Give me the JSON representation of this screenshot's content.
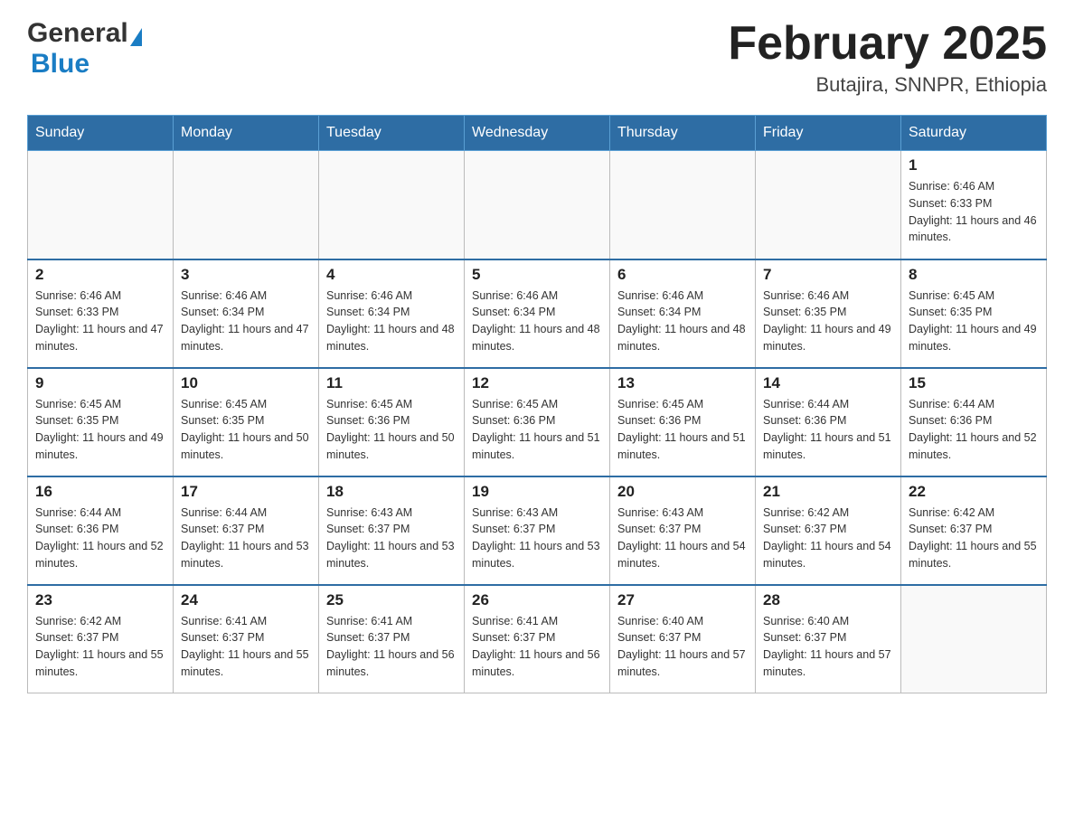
{
  "header": {
    "logo_general": "General",
    "logo_blue": "Blue",
    "month_title": "February 2025",
    "subtitle": "Butajira, SNNPR, Ethiopia"
  },
  "days_of_week": [
    "Sunday",
    "Monday",
    "Tuesday",
    "Wednesday",
    "Thursday",
    "Friday",
    "Saturday"
  ],
  "weeks": [
    [
      {
        "day": "",
        "sunrise": "",
        "sunset": "",
        "daylight": "",
        "empty": true
      },
      {
        "day": "",
        "sunrise": "",
        "sunset": "",
        "daylight": "",
        "empty": true
      },
      {
        "day": "",
        "sunrise": "",
        "sunset": "",
        "daylight": "",
        "empty": true
      },
      {
        "day": "",
        "sunrise": "",
        "sunset": "",
        "daylight": "",
        "empty": true
      },
      {
        "day": "",
        "sunrise": "",
        "sunset": "",
        "daylight": "",
        "empty": true
      },
      {
        "day": "",
        "sunrise": "",
        "sunset": "",
        "daylight": "",
        "empty": true
      },
      {
        "day": "1",
        "sunrise": "Sunrise: 6:46 AM",
        "sunset": "Sunset: 6:33 PM",
        "daylight": "Daylight: 11 hours and 46 minutes.",
        "empty": false
      }
    ],
    [
      {
        "day": "2",
        "sunrise": "Sunrise: 6:46 AM",
        "sunset": "Sunset: 6:33 PM",
        "daylight": "Daylight: 11 hours and 47 minutes.",
        "empty": false
      },
      {
        "day": "3",
        "sunrise": "Sunrise: 6:46 AM",
        "sunset": "Sunset: 6:34 PM",
        "daylight": "Daylight: 11 hours and 47 minutes.",
        "empty": false
      },
      {
        "day": "4",
        "sunrise": "Sunrise: 6:46 AM",
        "sunset": "Sunset: 6:34 PM",
        "daylight": "Daylight: 11 hours and 48 minutes.",
        "empty": false
      },
      {
        "day": "5",
        "sunrise": "Sunrise: 6:46 AM",
        "sunset": "Sunset: 6:34 PM",
        "daylight": "Daylight: 11 hours and 48 minutes.",
        "empty": false
      },
      {
        "day": "6",
        "sunrise": "Sunrise: 6:46 AM",
        "sunset": "Sunset: 6:34 PM",
        "daylight": "Daylight: 11 hours and 48 minutes.",
        "empty": false
      },
      {
        "day": "7",
        "sunrise": "Sunrise: 6:46 AM",
        "sunset": "Sunset: 6:35 PM",
        "daylight": "Daylight: 11 hours and 49 minutes.",
        "empty": false
      },
      {
        "day": "8",
        "sunrise": "Sunrise: 6:45 AM",
        "sunset": "Sunset: 6:35 PM",
        "daylight": "Daylight: 11 hours and 49 minutes.",
        "empty": false
      }
    ],
    [
      {
        "day": "9",
        "sunrise": "Sunrise: 6:45 AM",
        "sunset": "Sunset: 6:35 PM",
        "daylight": "Daylight: 11 hours and 49 minutes.",
        "empty": false
      },
      {
        "day": "10",
        "sunrise": "Sunrise: 6:45 AM",
        "sunset": "Sunset: 6:35 PM",
        "daylight": "Daylight: 11 hours and 50 minutes.",
        "empty": false
      },
      {
        "day": "11",
        "sunrise": "Sunrise: 6:45 AM",
        "sunset": "Sunset: 6:36 PM",
        "daylight": "Daylight: 11 hours and 50 minutes.",
        "empty": false
      },
      {
        "day": "12",
        "sunrise": "Sunrise: 6:45 AM",
        "sunset": "Sunset: 6:36 PM",
        "daylight": "Daylight: 11 hours and 51 minutes.",
        "empty": false
      },
      {
        "day": "13",
        "sunrise": "Sunrise: 6:45 AM",
        "sunset": "Sunset: 6:36 PM",
        "daylight": "Daylight: 11 hours and 51 minutes.",
        "empty": false
      },
      {
        "day": "14",
        "sunrise": "Sunrise: 6:44 AM",
        "sunset": "Sunset: 6:36 PM",
        "daylight": "Daylight: 11 hours and 51 minutes.",
        "empty": false
      },
      {
        "day": "15",
        "sunrise": "Sunrise: 6:44 AM",
        "sunset": "Sunset: 6:36 PM",
        "daylight": "Daylight: 11 hours and 52 minutes.",
        "empty": false
      }
    ],
    [
      {
        "day": "16",
        "sunrise": "Sunrise: 6:44 AM",
        "sunset": "Sunset: 6:36 PM",
        "daylight": "Daylight: 11 hours and 52 minutes.",
        "empty": false
      },
      {
        "day": "17",
        "sunrise": "Sunrise: 6:44 AM",
        "sunset": "Sunset: 6:37 PM",
        "daylight": "Daylight: 11 hours and 53 minutes.",
        "empty": false
      },
      {
        "day": "18",
        "sunrise": "Sunrise: 6:43 AM",
        "sunset": "Sunset: 6:37 PM",
        "daylight": "Daylight: 11 hours and 53 minutes.",
        "empty": false
      },
      {
        "day": "19",
        "sunrise": "Sunrise: 6:43 AM",
        "sunset": "Sunset: 6:37 PM",
        "daylight": "Daylight: 11 hours and 53 minutes.",
        "empty": false
      },
      {
        "day": "20",
        "sunrise": "Sunrise: 6:43 AM",
        "sunset": "Sunset: 6:37 PM",
        "daylight": "Daylight: 11 hours and 54 minutes.",
        "empty": false
      },
      {
        "day": "21",
        "sunrise": "Sunrise: 6:42 AM",
        "sunset": "Sunset: 6:37 PM",
        "daylight": "Daylight: 11 hours and 54 minutes.",
        "empty": false
      },
      {
        "day": "22",
        "sunrise": "Sunrise: 6:42 AM",
        "sunset": "Sunset: 6:37 PM",
        "daylight": "Daylight: 11 hours and 55 minutes.",
        "empty": false
      }
    ],
    [
      {
        "day": "23",
        "sunrise": "Sunrise: 6:42 AM",
        "sunset": "Sunset: 6:37 PM",
        "daylight": "Daylight: 11 hours and 55 minutes.",
        "empty": false
      },
      {
        "day": "24",
        "sunrise": "Sunrise: 6:41 AM",
        "sunset": "Sunset: 6:37 PM",
        "daylight": "Daylight: 11 hours and 55 minutes.",
        "empty": false
      },
      {
        "day": "25",
        "sunrise": "Sunrise: 6:41 AM",
        "sunset": "Sunset: 6:37 PM",
        "daylight": "Daylight: 11 hours and 56 minutes.",
        "empty": false
      },
      {
        "day": "26",
        "sunrise": "Sunrise: 6:41 AM",
        "sunset": "Sunset: 6:37 PM",
        "daylight": "Daylight: 11 hours and 56 minutes.",
        "empty": false
      },
      {
        "day": "27",
        "sunrise": "Sunrise: 6:40 AM",
        "sunset": "Sunset: 6:37 PM",
        "daylight": "Daylight: 11 hours and 57 minutes.",
        "empty": false
      },
      {
        "day": "28",
        "sunrise": "Sunrise: 6:40 AM",
        "sunset": "Sunset: 6:37 PM",
        "daylight": "Daylight: 11 hours and 57 minutes.",
        "empty": false
      },
      {
        "day": "",
        "sunrise": "",
        "sunset": "",
        "daylight": "",
        "empty": true
      }
    ]
  ]
}
